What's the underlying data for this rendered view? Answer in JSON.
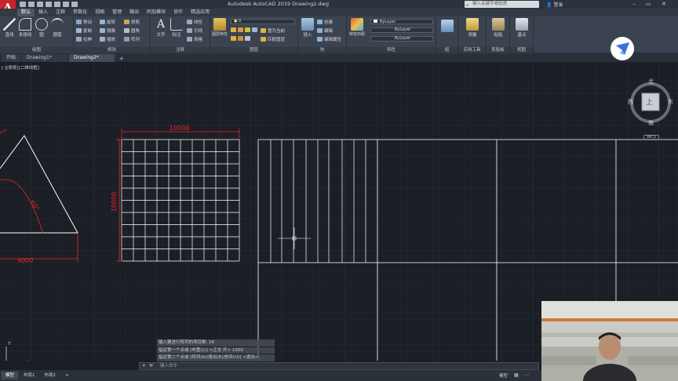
{
  "titlebar": {
    "app_title": "Autodesk AutoCAD 2019    Drawing2.dwg",
    "search_placeholder": "键入关键字或短语",
    "user_label": "登录"
  },
  "menu_tabs": [
    "默认",
    "插入",
    "注释",
    "参数化",
    "视图",
    "管理",
    "输出",
    "附加模块",
    "协作",
    "精选应用"
  ],
  "active_menu_tab": "默认",
  "ribbon": {
    "draw": {
      "title": "绘图",
      "big_buttons": [
        "直线",
        "多段线",
        "圆",
        "圆弧"
      ]
    },
    "modify": {
      "title": "修改",
      "items": [
        "移动",
        "旋转",
        "修剪",
        "复制",
        "镜像",
        "圆角",
        "拉伸",
        "缩放",
        "阵列"
      ]
    },
    "annotation": {
      "title": "注释",
      "big_buttons": [
        "文字",
        "标注"
      ],
      "items": [
        "线性",
        "引线",
        "表格"
      ]
    },
    "layers": {
      "title": "图层",
      "big_buttons": [
        "图层特性"
      ],
      "layer_value": "0",
      "items": [
        "置为当前",
        "匹配图层"
      ]
    },
    "block": {
      "title": "块",
      "big_buttons": [
        "插入"
      ],
      "items": [
        "创建",
        "编辑",
        "编辑属性"
      ]
    },
    "properties": {
      "title": "特性",
      "big_buttons": [
        "特性匹配"
      ],
      "color": "ByLayer",
      "linetype": "ByLayer",
      "lineweight": "ByLayer"
    },
    "groups": {
      "title": "组"
    },
    "utilities": {
      "title": "实用工具",
      "big_buttons": [
        "测量"
      ]
    },
    "clipboard": {
      "title": "剪贴板",
      "big_buttons": [
        "粘贴"
      ]
    },
    "view": {
      "title": "视图",
      "big_buttons": [
        "基点"
      ]
    }
  },
  "file_tabs": [
    "开始",
    "Drawing1*",
    "Drawing2*"
  ],
  "active_file_tab": "Drawing2*",
  "viewport_label": "[-][俯视][二维线框]",
  "drawing": {
    "grid_dim_top": "10000",
    "grid_dim_left": "10000",
    "triangle_base_dim": "9000",
    "triangle_angle_dim": "60°"
  },
  "viewcube": {
    "top": "上",
    "north": "北",
    "south": "南",
    "east": "东",
    "west": "西",
    "wcs": "WCS"
  },
  "ucs": {
    "x": "X",
    "y": "Y"
  },
  "command_history": [
    "输入要进行阵列的项目数: 16",
    "指定第一个点或 [布置(L)] <正交 开> 1000",
    "指定第二个点或 [阵列(A)/退出(E)/放弃(U)] <退出>:"
  ],
  "command_placeholder": "键入命令",
  "layout_tabs": [
    "模型",
    "布局1",
    "布局2"
  ],
  "active_layout_tab": "模型",
  "status": {
    "model_label": "模型"
  },
  "colors": {
    "canvas": "#1b1f25",
    "dimension": "#e8262b",
    "geometry": "#ffffff",
    "accent_logo": "#c8242b"
  }
}
